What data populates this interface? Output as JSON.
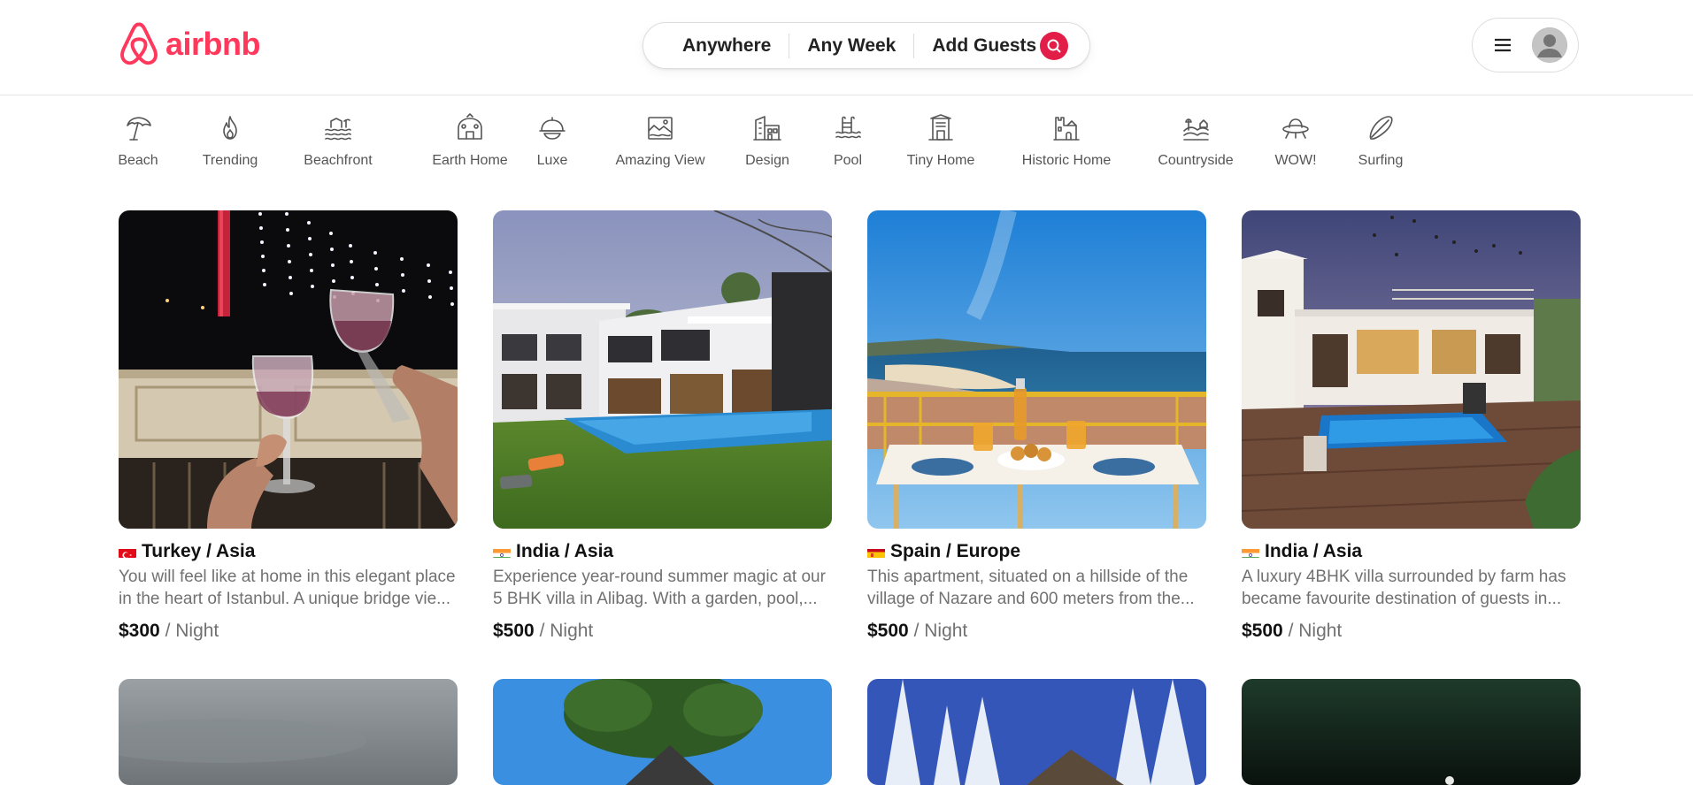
{
  "brand": {
    "name": "airbnb",
    "color": "#ff385c"
  },
  "search": {
    "where": "Anywhere",
    "when": "Any Week",
    "guests": "Add Guests",
    "button_color": "#e11d48"
  },
  "categories": [
    {
      "label": "Beach",
      "icon": "beach-umbrella-icon"
    },
    {
      "label": "Trending",
      "icon": "flame-icon"
    },
    {
      "label": "Beachfront",
      "icon": "beachfront-icon"
    },
    {
      "label": "Earth Home",
      "icon": "earth-home-icon"
    },
    {
      "label": "Luxe",
      "icon": "luxe-icon"
    },
    {
      "label": "Amazing View",
      "icon": "amazing-view-icon"
    },
    {
      "label": "Design",
      "icon": "design-building-icon"
    },
    {
      "label": "Pool",
      "icon": "pool-icon"
    },
    {
      "label": "Tiny Home",
      "icon": "tiny-home-icon"
    },
    {
      "label": "Historic Home",
      "icon": "castle-icon"
    },
    {
      "label": "Countryside",
      "icon": "countryside-icon"
    },
    {
      "label": "WOW!",
      "icon": "ufo-icon"
    },
    {
      "label": "Surfing",
      "icon": "surfboard-icon"
    }
  ],
  "listings": [
    {
      "location": "Turkey / Asia",
      "flag": "turkey",
      "desc_line1": "You will feel like at home in this elegant place",
      "desc_line2": "in the heart of Istanbul. A unique bridge vie...",
      "price": "$300",
      "unit": "/ Night",
      "image": "wine-glasses-night-bridge"
    },
    {
      "location": "India / Asia",
      "flag": "india",
      "desc_line1": "Experience year-round summer magic at our",
      "desc_line2": "5 BHK villa in Alibag. With a garden, pool,...",
      "price": "$500",
      "unit": "/ Night",
      "image": "white-villa-pool-lawn"
    },
    {
      "location": "Spain / Europe",
      "flag": "spain",
      "desc_line1": "This apartment, situated on a hillside of the",
      "desc_line2": "village of Nazare and 600 meters from the...",
      "price": "$500",
      "unit": "/ Night",
      "image": "balcony-breakfast-sea-view"
    },
    {
      "location": "India / Asia",
      "flag": "india",
      "desc_line1": "A luxury 4BHK villa surrounded by farm has",
      "desc_line2": "became favourite destination of guests in...",
      "price": "$500",
      "unit": "/ Night",
      "image": "villa-pool-dusk"
    }
  ]
}
